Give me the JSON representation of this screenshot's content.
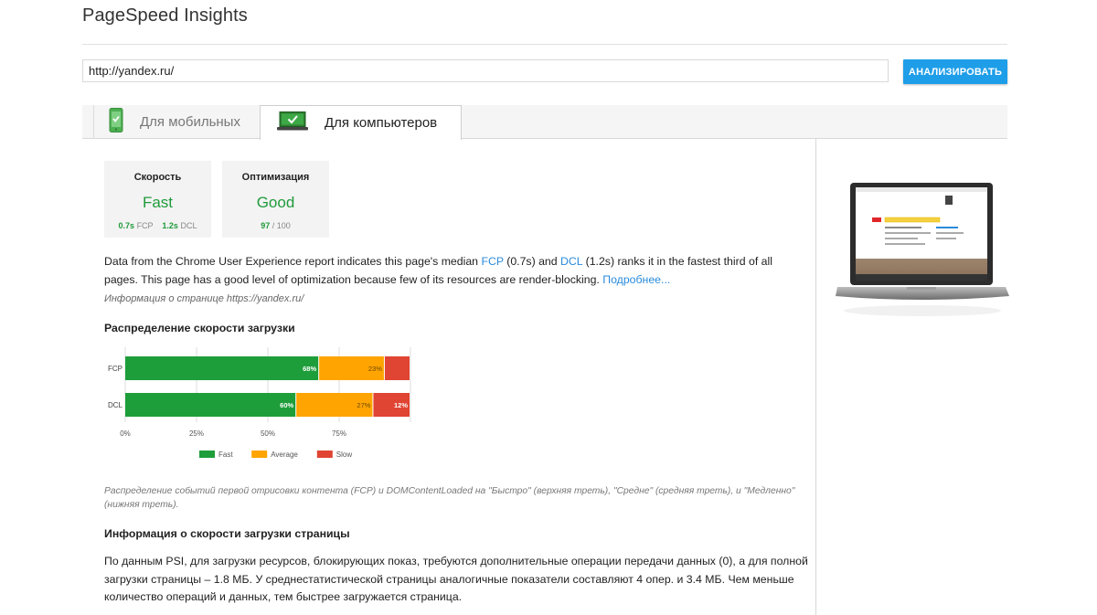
{
  "app": {
    "title": "PageSpeed Insights"
  },
  "search": {
    "url": "http://yandex.ru/",
    "button_label": "АНАЛИЗИРОВАТЬ"
  },
  "tabs": [
    {
      "label": "Для мобильных",
      "icon": "mobile-phone-check-icon",
      "active": false
    },
    {
      "label": "Для компьютеров",
      "icon": "laptop-check-icon",
      "active": true
    }
  ],
  "cards": {
    "speed": {
      "label": "Скорость",
      "value": "Fast",
      "fcp_value": "0.7s",
      "fcp_label": "FCP",
      "dcl_value": "1.2s",
      "dcl_label": "DCL"
    },
    "optimization": {
      "label": "Оптимизация",
      "value": "Good",
      "score": "97",
      "max": "/ 100"
    }
  },
  "summary": {
    "part1": "Data from the Chrome User Experience report indicates this page's median ",
    "fcp_link": "FCP",
    "part2": " (0.7s) and ",
    "dcl_link": "DCL",
    "part3": " (1.2s) ranks it in the fastest third of all pages. This page has a good level of optimization because few of its resources are render-blocking. ",
    "more_link": "Подробнее..."
  },
  "page_info": "Информация о странице https://yandex.ru/",
  "distribution": {
    "title": "Распределение скорости загрузки",
    "caption": "Распределение событий первой отрисовки контента (FCP) и DOMContentLoaded на \"Быстро\" (верхняя треть), \"Средне\" (средняя треть), и \"Медленно\" (нижняя треть)."
  },
  "chart_data": {
    "type": "bar",
    "orientation": "horizontal",
    "stacked": true,
    "categories": [
      "FCP",
      "DCL"
    ],
    "series": [
      {
        "name": "Fast",
        "values": [
          68,
          60
        ],
        "labels": [
          "68%",
          "60%"
        ],
        "color": "#1e9e3a"
      },
      {
        "name": "Average",
        "values": [
          23,
          27
        ],
        "labels": [
          "23%",
          "27%"
        ],
        "color": "#ffa400"
      },
      {
        "name": "Slow",
        "values": [
          9,
          13
        ],
        "labels": [
          "",
          "12%"
        ],
        "color": "#e04433"
      }
    ],
    "xticks": [
      "0%",
      "25%",
      "50%",
      "75%"
    ],
    "xlim": [
      0,
      100
    ],
    "grid": true,
    "legend_position": "bottom"
  },
  "speed_info": {
    "title": "Информация о скорости загрузки страницы",
    "text": "По данным PSI, для загрузки ресурсов, блокирующих показ, требуются дополнительные операции передачи данных (0), а для полной загрузки страницы – 1.8 МБ. У среднестатистической страницы аналогичные показатели составляют 4 опер. и 3.4 МБ. Чем меньше количество операций и данных, тем быстрее загружается страница."
  },
  "colors": {
    "accent": "#1e9ee8",
    "good": "#1f9b3b",
    "link": "#2a8bdb"
  }
}
